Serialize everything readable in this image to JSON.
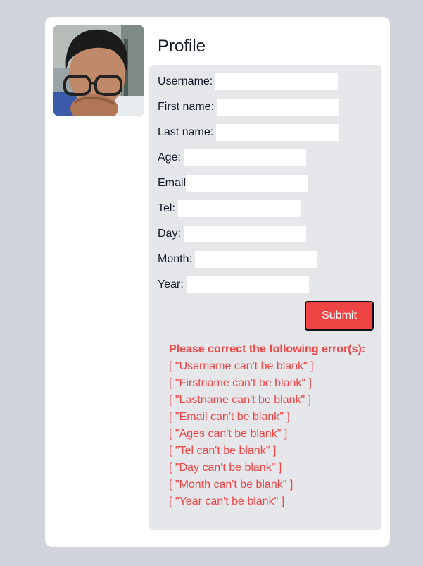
{
  "profile": {
    "title": "Profile"
  },
  "form": {
    "fields": [
      {
        "label": "Username:",
        "value": ""
      },
      {
        "label": "First name:",
        "value": ""
      },
      {
        "label": "Last name:",
        "value": ""
      },
      {
        "label": "Age:",
        "value": ""
      },
      {
        "label": "Email",
        "value": ""
      },
      {
        "label": "Tel:",
        "value": ""
      },
      {
        "label": "Day:",
        "value": ""
      },
      {
        "label": "Month:",
        "value": ""
      },
      {
        "label": "Year:",
        "value": ""
      }
    ],
    "submit_label": "Submit"
  },
  "errors": {
    "heading": "Please correct the following error(s):",
    "items": [
      "[ \"Username can't be blank\" ]",
      "[ \"Firstname can't be blank\" ]",
      "[ \"Lastname can't be blank\" ]",
      "[ \"Email can't be blank\" ]",
      "[ \"Ages can't be blank\" ]",
      "[ \"Tel can't be blank\" ]",
      "[ \"Day can't be blank\" ]",
      "[ \"Month can't be blank\" ]",
      "[ \"Year can't be blank\" ]"
    ]
  },
  "colors": {
    "page_background": "#d1d5db",
    "panel_background": "#e5e7eb",
    "error_text": "#ef4444",
    "submit_button": "#ef4444"
  }
}
